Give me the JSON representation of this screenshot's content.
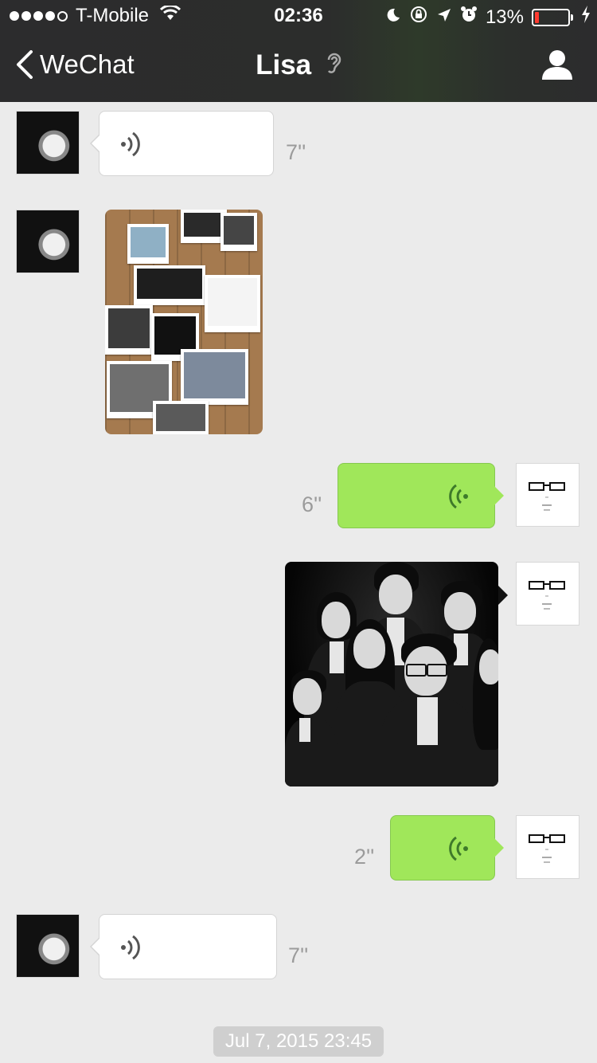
{
  "status_bar": {
    "carrier": "T-Mobile",
    "time": "02:36",
    "battery_percent": "13%",
    "battery_level": 0.13,
    "signal_bars": 4,
    "icons": [
      "wifi-icon",
      "moon-icon",
      "rotation-lock-icon",
      "location-icon",
      "alarm-icon",
      "charging-icon"
    ]
  },
  "nav": {
    "back_label": "WeChat",
    "title": "Lisa",
    "title_icon": "ear-icon",
    "right_icon": "profile-icon"
  },
  "messages": [
    {
      "sender": "Lisa",
      "type": "voice",
      "duration": "7''"
    },
    {
      "sender": "Lisa",
      "type": "image",
      "content": "photo-board-image"
    },
    {
      "sender": "me",
      "type": "voice",
      "duration": "6''"
    },
    {
      "sender": "me",
      "type": "image",
      "content": "group-photo-image"
    },
    {
      "sender": "me",
      "type": "voice",
      "duration": "2''"
    },
    {
      "sender": "Lisa",
      "type": "voice",
      "duration": "7''"
    }
  ],
  "timestamp": "Jul 7, 2015 23:45",
  "colors": {
    "header_bg": "#2c2c2d",
    "chat_bg": "#ebebeb",
    "outgoing_bubble": "#a0e75a",
    "incoming_bubble": "#ffffff",
    "battery_low": "#ff3b30"
  }
}
